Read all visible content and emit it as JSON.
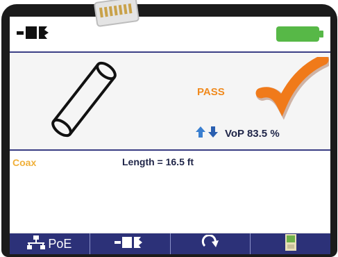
{
  "status_bar": {
    "cable_type_icon": "cable-connector-icon",
    "battery_icon": "battery-full-icon",
    "battery_color": "#57b847"
  },
  "result": {
    "cable_icon": "coax-cable-icon",
    "status": "PASS",
    "status_color": "#f08a1e",
    "check_icon": "checkmark-icon",
    "vop_text": "VoP 83.5 %",
    "vop_arrows": [
      "up-arrow-icon",
      "down-arrow-icon"
    ]
  },
  "info": {
    "cable_type": "Coax",
    "length_text": "Length = 16.5 ft"
  },
  "softkeys": [
    {
      "icon": "network-icon",
      "label": "PoE"
    },
    {
      "icon": "cable-connector-icon",
      "label": ""
    },
    {
      "icon": "refresh-icon",
      "label": ""
    },
    {
      "icon": "remote-unit-icon",
      "label": ""
    }
  ],
  "colors": {
    "accent": "#2c3178",
    "coax_label": "#f0b03a",
    "arrow": "#3a7fd0"
  }
}
